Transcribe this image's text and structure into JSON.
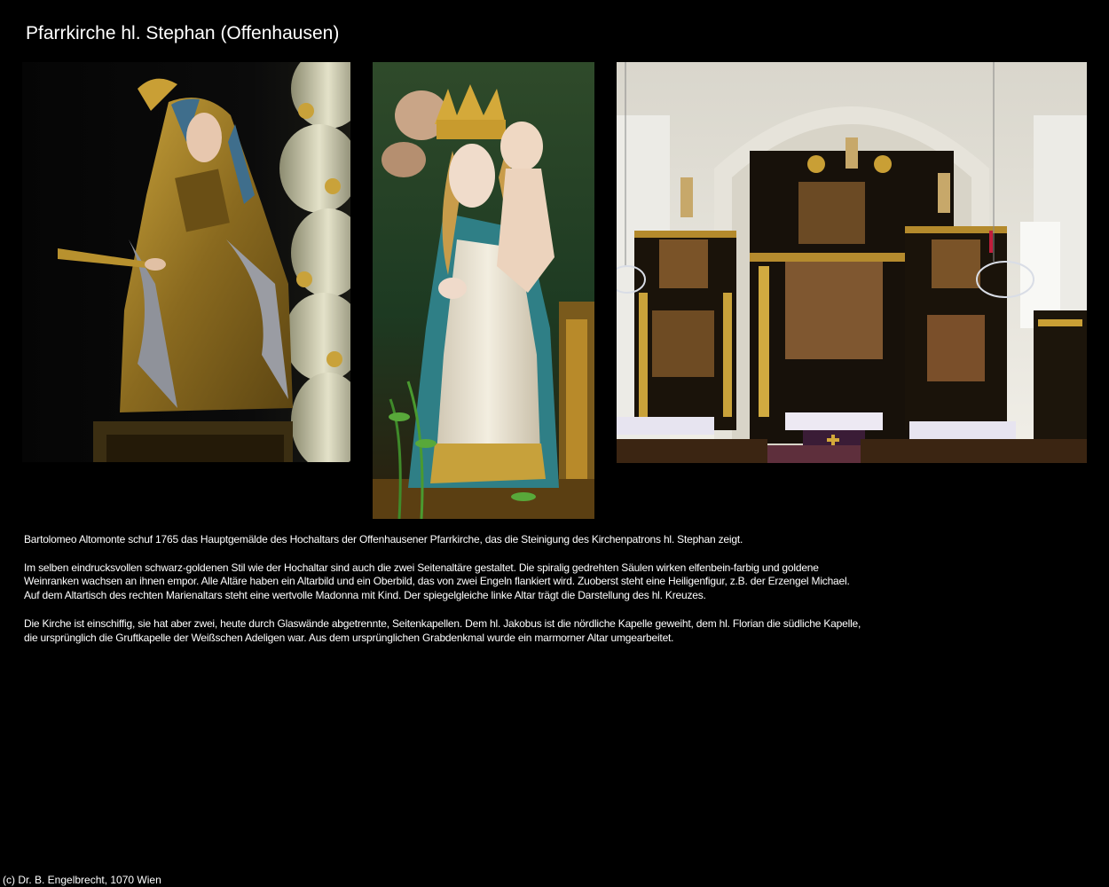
{
  "page": {
    "title": "Pfarrkirche hl. Stephan (Offenhausen)"
  },
  "photos": [
    {
      "icon": "saint-statue-photo"
    },
    {
      "icon": "madonna-statue-photo"
    },
    {
      "icon": "church-interior-altar-photo"
    }
  ],
  "paragraphs": [
    "Bartolomeo Altomonte schuf 1765 das Hauptgemälde des Hochaltars der Offenhausener Pfarrkirche, das die Steinigung des Kirchenpatrons hl. Stephan zeigt.",
    "Im selben eindrucksvollen schwarz-goldenen Stil wie der Hochaltar sind auch die zwei Seitenaltäre gestaltet. Die spiralig gedrehten Säulen wirken elfenbein-farbig und goldene Weinranken wachsen an ihnen empor. Alle Altäre haben ein Altarbild und ein Oberbild, das von zwei Engeln flankiert wird. Zuoberst steht eine Heiligenfigur, z.B. der Erzengel Michael. Auf dem Altartisch des rechten Marienaltars steht eine wertvolle Madonna mit Kind. Der spiegelgleiche linke Altar trägt die Darstellung des hl. Kreuzes.",
    "Die Kirche ist einschiffig, sie hat aber zwei, heute durch Glaswände abgetrennte, Seitenkapellen. Dem hl. Jakobus ist die nördliche Kapelle geweiht, dem hl. Florian die südliche Kapelle, die ursprünglich die Gruftkapelle der Weißschen Adeligen war. Aus dem ursprünglichen Grabdenkmal wurde ein marmorner Altar umgearbeitet."
  ],
  "footer": {
    "copyright": "(c) Dr. B. Engelbrecht, 1070 Wien"
  }
}
